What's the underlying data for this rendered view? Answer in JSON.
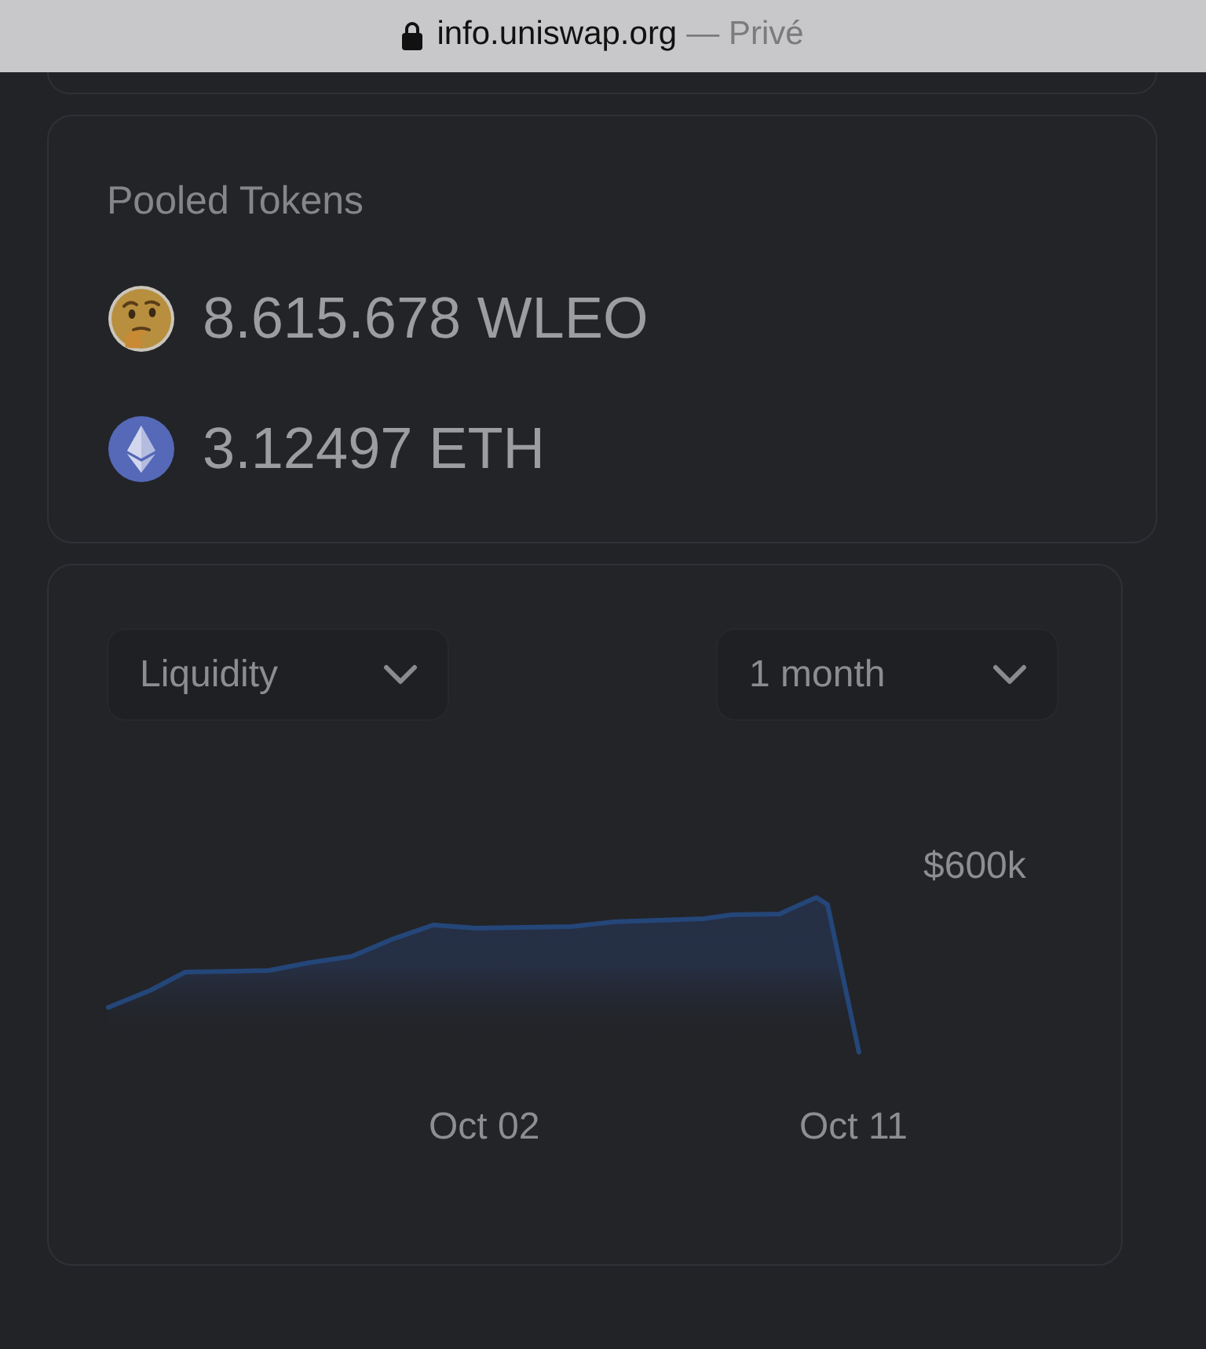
{
  "browser": {
    "domain": "info.uniswap.org",
    "mode": "— Privé"
  },
  "pooled_tokens": {
    "title": "Pooled Tokens",
    "tokens": [
      {
        "kind": "emoji",
        "amount": "8.615.678 WLEO"
      },
      {
        "kind": "ether",
        "amount": "3.12497 ETH"
      }
    ]
  },
  "chart": {
    "dropdowns": [
      {
        "value": "Liquidity"
      },
      {
        "value": "1 month"
      }
    ],
    "y_tick": "$600k",
    "x_ticks": [
      "Oct 02",
      "Oct 11"
    ]
  }
}
